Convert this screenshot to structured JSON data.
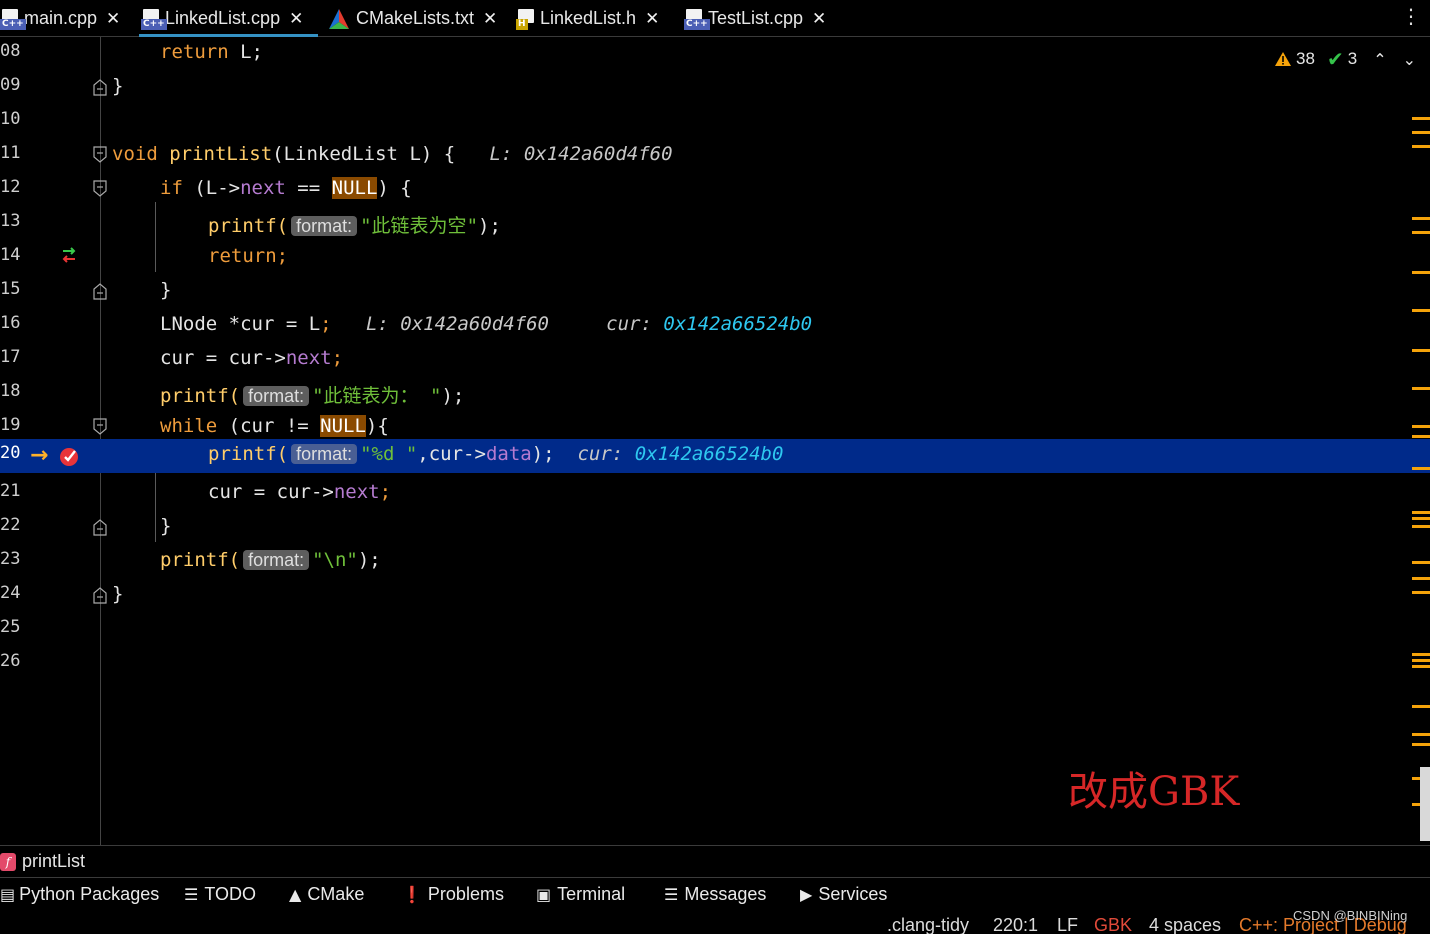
{
  "tabs": [
    {
      "label": "main.cpp",
      "badge": "C++",
      "icon": "cpp-file-icon",
      "active": false
    },
    {
      "label": "LinkedList.cpp",
      "badge": "C++",
      "icon": "cpp-file-icon",
      "active": true
    },
    {
      "label": "CMakeLists.txt",
      "badge": "",
      "icon": "cmake-icon",
      "active": false
    },
    {
      "label": "LinkedList.h",
      "badge": "H",
      "icon": "header-file-icon",
      "active": false
    },
    {
      "label": "TestList.cpp",
      "badge": "C++",
      "icon": "cpp-file-icon",
      "active": false
    }
  ],
  "tab_close_glyph": "✕",
  "tab_menu_glyph": "⋮",
  "colors": {
    "keyword": "#ee9c3c",
    "function": "#ffcd6a",
    "field": "#b57bd0",
    "string": "#6fbf3a",
    "current_line": "#002a8a",
    "debug_value": "#2ec8f0",
    "annotation": "#d62727",
    "warning": "#f5a30a"
  },
  "inspections": {
    "warnings": "38",
    "weak_warnings": "3",
    "up_glyph": "⌃",
    "down_glyph": "⌄"
  },
  "lines": {
    "l08": {
      "num": "08",
      "ret": "return",
      "rest": " L;"
    },
    "l09": {
      "num": "09",
      "text": "}"
    },
    "l10": {
      "num": "10"
    },
    "l11": {
      "num": "11",
      "kw": "void",
      "fn": "printList",
      "rest": "(LinkedList L) {",
      "inlay": "L: 0x142a60d4f60"
    },
    "l12": {
      "num": "12",
      "kw": "if",
      "a": " (L->",
      "field": "next",
      "b": " == ",
      "null": "NULL",
      "c": ") {"
    },
    "l13": {
      "num": "13",
      "fn": "printf(",
      "hint": "format:",
      "str_q": "\"",
      "str_cjk": "此链表为空",
      "str_end": "\"",
      "end": ");"
    },
    "l14": {
      "num": "14",
      "ret": "return",
      "end": ";"
    },
    "l15": {
      "num": "15",
      "text": "}"
    },
    "l16": {
      "num": "16",
      "a": "LNode *cur = L",
      "semi": ";",
      "inlay1": "L: 0x142a60d4f60",
      "inlay2_label": "cur:",
      "inlay2_value": "0x142a66524b0"
    },
    "l17": {
      "num": "17",
      "a": "cur = cur->",
      "field": "next",
      "semi": ";"
    },
    "l18": {
      "num": "18",
      "fn": "printf(",
      "hint": "format:",
      "str_q": "\"",
      "str_cjk": "此链表为：",
      "str_end": " \"",
      "end": ");"
    },
    "l19": {
      "num": "19",
      "kw": "while",
      "a": " (cur != ",
      "null": "NULL",
      "b": "){"
    },
    "l20": {
      "num": "20",
      "fn": "printf(",
      "hint": "format:",
      "str": "\"%d \"",
      "a": ",cur->",
      "field": "data",
      "end": ");",
      "inlay_label": "cur:",
      "inlay_value": "0x142a66524b0"
    },
    "l21": {
      "num": "21",
      "a": "cur = cur->",
      "field": "next",
      "semi": ";"
    },
    "l22": {
      "num": "22",
      "text": "}"
    },
    "l23": {
      "num": "23",
      "fn": "printf(",
      "hint": "format:",
      "str": "\"\\n\"",
      "end": ");"
    },
    "l24": {
      "num": "24",
      "text": "}"
    },
    "l25": {
      "num": "25"
    },
    "l26": {
      "num": "26"
    }
  },
  "annotation": "改成GBK",
  "breadcrumb": {
    "icon_letter": "f",
    "label": "printList"
  },
  "tool_windows": [
    {
      "label": "Python Packages",
      "icon": "python-packages-icon",
      "glyph": ""
    },
    {
      "label": "TODO",
      "icon": "todo-list-icon",
      "glyph": "☰"
    },
    {
      "label": "CMake",
      "icon": "cmake-icon",
      "glyph": "▲"
    },
    {
      "label": "Problems",
      "icon": "problems-icon",
      "glyph": "❗"
    },
    {
      "label": "Terminal",
      "icon": "terminal-icon",
      "glyph": "▣"
    },
    {
      "label": "Messages",
      "icon": "messages-icon",
      "glyph": "☰"
    },
    {
      "label": "Services",
      "icon": "services-icon",
      "glyph": "▶"
    }
  ],
  "status": {
    "linter": ".clang-tidy",
    "position": "220:1",
    "line_sep": "LF",
    "encoding": "GBK",
    "indent": "4 spaces",
    "context": "C++: Project | Debug"
  },
  "watermark": "CSDN @BINBINing"
}
